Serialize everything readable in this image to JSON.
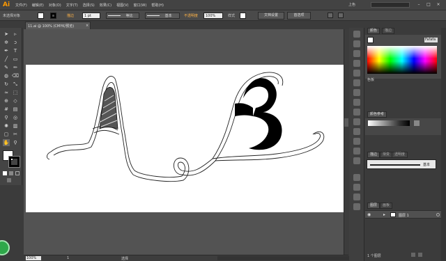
{
  "app": {
    "logo": "Ai"
  },
  "menus": [
    "文件(F)",
    "编辑(E)",
    "对象(O)",
    "文字(T)",
    "选择(S)",
    "效果(C)",
    "视图(V)",
    "窗口(W)",
    "帮助(H)"
  ],
  "workspace": {
    "label": "上色"
  },
  "control_bar": {
    "selection_label": "未选择对象",
    "stroke_label": "描边",
    "stroke_weight": "1 pt",
    "stroke_profile": "等比",
    "brush": "基本",
    "opacity_label": "不透明度",
    "opacity_value": "100%",
    "style_label": "样式",
    "doc_setup_button": "文档设置",
    "preferences_button": "首选项"
  },
  "document": {
    "tab_title": "11.ai @ 100% (CMYK/预览)",
    "close_glyph": "×"
  },
  "status_bar": {
    "zoom": "100%",
    "page": "1",
    "tool_name": "选择"
  },
  "panels": {
    "color": {
      "tabs": [
        "颜色",
        "描边"
      ],
      "hex": "Fafafa",
      "section": "色板"
    },
    "guide": {
      "title": "颜色参考"
    },
    "stroke": {
      "tabs": [
        "描边",
        "渐变",
        "透明度"
      ],
      "profile": "基本"
    },
    "layers": {
      "tabs": [
        "图层",
        "画板"
      ],
      "layer_name": "图层 1",
      "count_label": "1 个图层"
    }
  },
  "colors": {
    "fill": "#ffffff",
    "stroke": "#000000",
    "accent": "#ff9a00"
  },
  "icons": [
    "selection-tool",
    "direct-selection-tool",
    "magic-wand",
    "lasso",
    "pen",
    "type",
    "line",
    "rectangle",
    "paintbrush",
    "pencil",
    "blob-brush",
    "eraser",
    "rotate",
    "scale",
    "warp",
    "free-transform",
    "shape-builder",
    "perspective",
    "mesh",
    "gradient",
    "eyedropper",
    "blend",
    "symbol-sprayer",
    "column-graph",
    "artboard",
    "slice",
    "hand",
    "zoom"
  ]
}
